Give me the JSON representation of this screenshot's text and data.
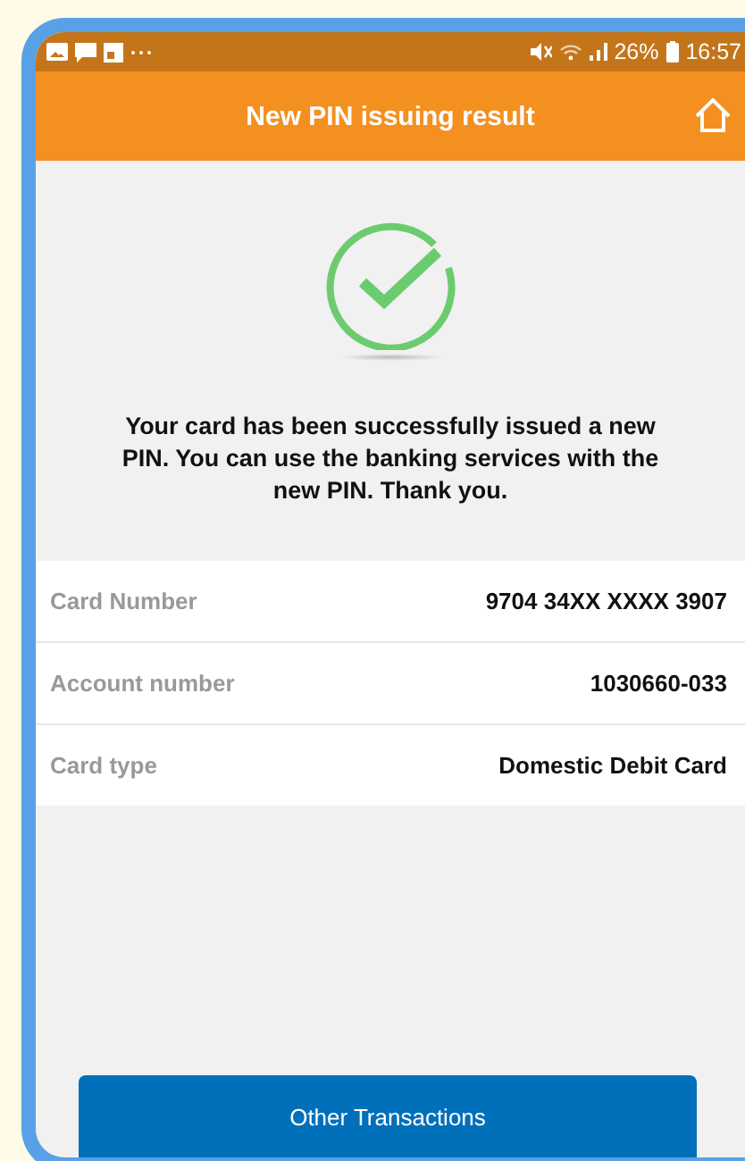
{
  "status_bar": {
    "battery": "26%",
    "time": "16:57"
  },
  "header": {
    "title": "New PIN issuing result"
  },
  "message": "Your card has been successfully issued a new PIN. You can use the banking services with the new PIN. Thank you.",
  "details": [
    {
      "label": "Card Number",
      "value": "9704 34XX XXXX 3907"
    },
    {
      "label": "Account number",
      "value": "1030660-033"
    },
    {
      "label": "Card type",
      "value": "Domestic Debit Card"
    }
  ],
  "button": "Other Transactions"
}
